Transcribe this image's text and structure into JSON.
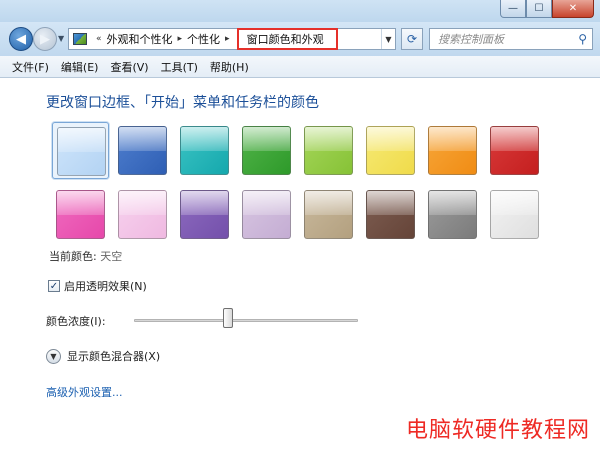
{
  "window": {
    "buttons": {
      "minimize": "—",
      "maximize": "☐",
      "close": "✕"
    }
  },
  "nav": {
    "back_icon": "back-arrow-icon",
    "forward_icon": "forward-arrow-icon",
    "breadcrumb": {
      "root_marker": "«",
      "items": [
        "外观和个性化",
        "个性化",
        "窗口颜色和外观"
      ],
      "separator": "▸"
    },
    "refresh_icon": "refresh-icon",
    "search_placeholder": "搜索控制面板"
  },
  "menu": [
    "文件(F)",
    "编辑(E)",
    "查看(V)",
    "工具(T)",
    "帮助(H)"
  ],
  "main": {
    "heading": "更改窗口边框、「开始」菜单和任务栏的颜色",
    "swatches": [
      {
        "color": "#cfe5fb",
        "accent": "#b3d3f3",
        "selected": true
      },
      {
        "color": "#4f7fcf",
        "accent": "#2f5fb4"
      },
      {
        "color": "#3cc4c4",
        "accent": "#15a8ad"
      },
      {
        "color": "#52b44a",
        "accent": "#2e9a2a"
      },
      {
        "color": "#a6d65a",
        "accent": "#86c236"
      },
      {
        "color": "#f6ea76",
        "accent": "#f0db4a"
      },
      {
        "color": "#f7a73a",
        "accent": "#f08c14"
      },
      {
        "color": "#d93a3a",
        "accent": "#c41f1f"
      },
      {
        "color": "#f06cc0",
        "accent": "#e648aa"
      },
      {
        "color": "#f7d2ee",
        "accent": "#efb9e1"
      },
      {
        "color": "#8d6bbf",
        "accent": "#7450ab"
      },
      {
        "color": "#d8c6e2",
        "accent": "#c4add3"
      },
      {
        "color": "#c9b99d",
        "accent": "#b3a07f"
      },
      {
        "color": "#7e5e52",
        "accent": "#654438"
      },
      {
        "color": "#9c9c9c",
        "accent": "#7b7b7b"
      },
      {
        "color": "#f3f3f3",
        "accent": "#dfdfdf"
      }
    ],
    "current_color_label": "当前颜色:",
    "current_color_value": "天空",
    "transparency_label": "启用透明效果(N)",
    "transparency_checked": "✓",
    "intensity_label": "颜色浓度(I):",
    "intensity_level": 0.42,
    "mixer_label": "显示颜色混合器(X)",
    "advanced_link": "高级外观设置..."
  },
  "watermark": "电脑软硬件教程网"
}
